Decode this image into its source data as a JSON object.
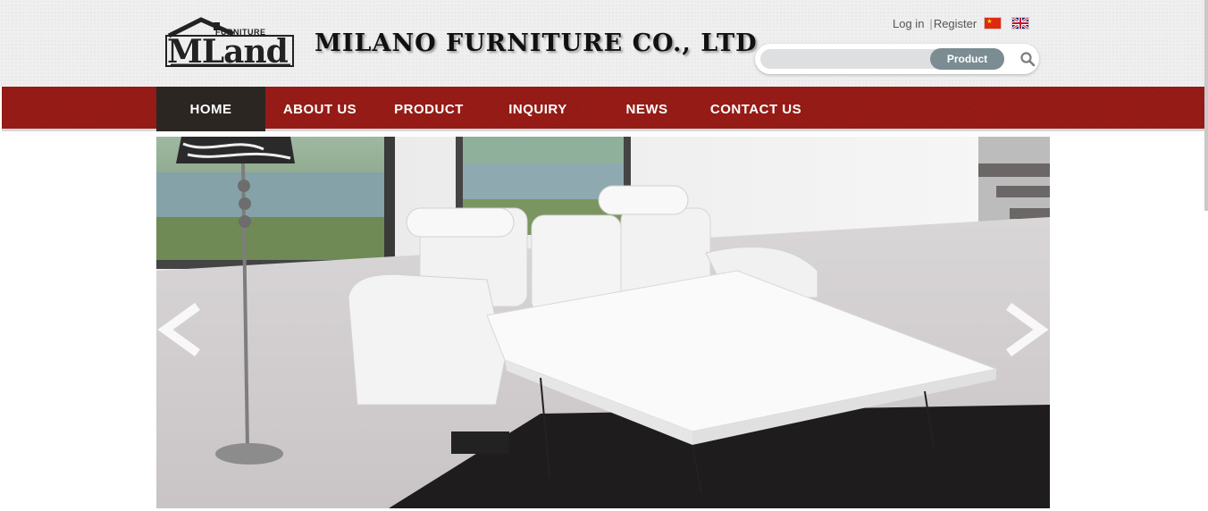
{
  "header": {
    "logo": {
      "small_text": "FURNITURE",
      "word": "MLand"
    },
    "company_name": "MILANO FURNITURE CO., LTD",
    "links": {
      "login": "Log in",
      "separator": "|",
      "register": "Register"
    },
    "flags": [
      "china-flag-icon",
      "uk-flag-icon"
    ]
  },
  "search": {
    "value": "",
    "placeholder": "",
    "category": "Product",
    "button_icon": "search-icon"
  },
  "nav": {
    "items": [
      {
        "label": "HOME",
        "active": true
      },
      {
        "label": "ABOUT US"
      },
      {
        "label": "PRODUCT"
      },
      {
        "label": "INQUIRY"
      },
      {
        "label": "NEWS"
      },
      {
        "label": "CONTACT US"
      }
    ]
  },
  "banner": {
    "prev_icon": "chevron-left-icon",
    "next_icon": "chevron-right-icon"
  },
  "colors": {
    "nav_red": "#9b1c17",
    "nav_active": "#2c2623",
    "search_pill": "#7b8c93"
  }
}
